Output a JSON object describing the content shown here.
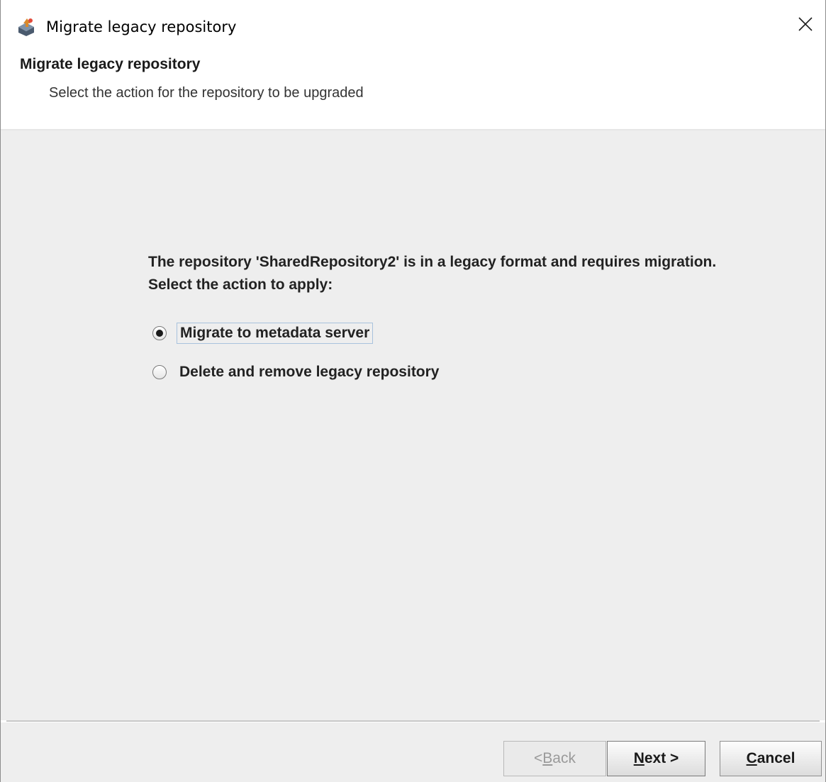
{
  "window": {
    "title": "Migrate legacy repository",
    "app_icon": "wizard-app-icon",
    "close_icon": "close-icon"
  },
  "header": {
    "title": "Migrate legacy repository",
    "subtitle": "Select the action for the repository to be upgraded"
  },
  "content": {
    "message_line1": "The repository 'SharedRepository2' is in a legacy format and requires migration.",
    "message_line2": "Select the action to apply:",
    "options": [
      {
        "label": "Migrate to metadata server",
        "selected": true
      },
      {
        "label": "Delete and remove legacy repository",
        "selected": false
      }
    ]
  },
  "footer": {
    "back": {
      "prefix": "< ",
      "mnemonic": "B",
      "rest": "ack",
      "enabled": false
    },
    "next": {
      "mnemonic": "N",
      "rest": "ext >"
    },
    "cancel": {
      "mnemonic": "C",
      "rest": "ancel"
    }
  }
}
